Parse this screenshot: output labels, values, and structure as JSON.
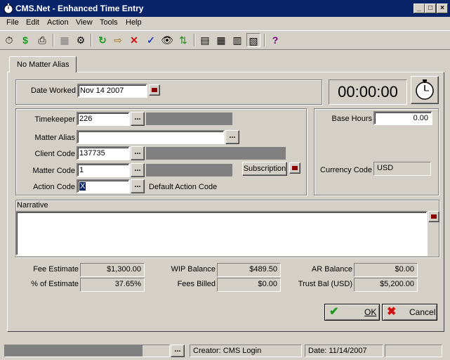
{
  "window": {
    "title": "CMS.Net - Enhanced Time Entry",
    "min": "_",
    "max": "□",
    "close": "×"
  },
  "menu": [
    "File",
    "Edit",
    "Action",
    "View",
    "Tools",
    "Help"
  ],
  "toolbar_glyphs": {
    "stopwatch": "⏱",
    "money": "$",
    "print": "⎙",
    "calc": "▦",
    "gear": "⚙",
    "refresh": "↻",
    "export": "⇨",
    "delete": "✕",
    "spell": "✓",
    "find": "👁",
    "sort": "⇅",
    "grid1": "▤",
    "grid2": "▦",
    "grid3": "▥",
    "grid4": "▧",
    "help": "?"
  },
  "tab": {
    "label": "No Matter Alias"
  },
  "date_worked": {
    "label": "Date Worked",
    "value": "Nov 14 2007"
  },
  "timer": {
    "value": "00:00:00"
  },
  "timekeeper": {
    "label": "Timekeeper",
    "value": "226"
  },
  "matter_alias": {
    "label": "Matter Alias",
    "value": ""
  },
  "client_code": {
    "label": "Client Code",
    "value": "137735"
  },
  "matter_code": {
    "label": "Matter Code",
    "value": "1"
  },
  "action_code": {
    "label": "Action Code",
    "value": "X",
    "description": "Default Action Code"
  },
  "subscription": {
    "label": "Subscription"
  },
  "base_hours": {
    "label": "Base Hours",
    "value": "0.00"
  },
  "currency": {
    "label": "Currency Code",
    "value": "USD"
  },
  "narrative": {
    "label": "Narrative",
    "value": ""
  },
  "summary": {
    "fee_estimate": {
      "label": "Fee Estimate",
      "value": "$1,300.00"
    },
    "pct_estimate": {
      "label": "% of Estimate",
      "value": "37.65%"
    },
    "wip_balance": {
      "label": "WIP Balance",
      "value": "$489.50"
    },
    "fees_billed": {
      "label": "Fees Billed",
      "value": "$0.00"
    },
    "ar_balance": {
      "label": "AR Balance",
      "value": "$0.00"
    },
    "trust_bal": {
      "label": "Trust Bal (USD)",
      "value": "$5,200.00"
    }
  },
  "buttons": {
    "ok": "OK",
    "cancel": "Cancel",
    "dots": "..."
  },
  "status": {
    "creator": "Creator: CMS Login",
    "date": "Date: 11/14/2007"
  },
  "colors": {
    "title_bar": "#0a246a",
    "face": "#d4d0c8",
    "ok_check": "#1a9a1a",
    "cancel_x": "#d01010"
  }
}
